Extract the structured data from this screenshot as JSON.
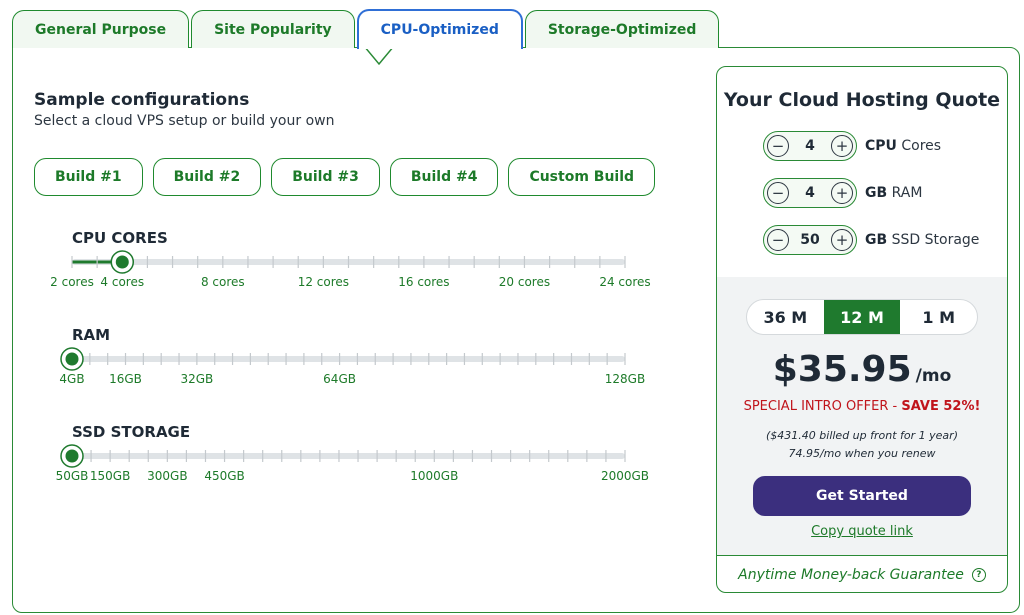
{
  "tabs": [
    {
      "label": "General Purpose",
      "active": false
    },
    {
      "label": "Site Popularity",
      "active": false
    },
    {
      "label": "CPU-Optimized",
      "active": true
    },
    {
      "label": "Storage-Optimized",
      "active": false
    }
  ],
  "configs": {
    "title": "Sample configurations",
    "subtitle": "Select a cloud VPS setup or build your own",
    "builds": [
      "Build #1",
      "Build #2",
      "Build #3",
      "Build #4",
      "Custom Build"
    ]
  },
  "sliders": [
    {
      "label": "CPU CORES",
      "value": 4,
      "min": 2,
      "max": 24,
      "tick_values": [
        2,
        3,
        4,
        5,
        6,
        7,
        8,
        9,
        10,
        11,
        12,
        13,
        14,
        15,
        16,
        17,
        18,
        19,
        20,
        21,
        22,
        23,
        24
      ],
      "labels": [
        {
          "value": 2,
          "text": "2 cores"
        },
        {
          "value": 4,
          "text": "4 cores"
        },
        {
          "value": 8,
          "text": "8 cores"
        },
        {
          "value": 12,
          "text": "12 cores"
        },
        {
          "value": 16,
          "text": "16 cores"
        },
        {
          "value": 20,
          "text": "20 cores"
        },
        {
          "value": 24,
          "text": "24 cores"
        }
      ]
    },
    {
      "label": "RAM",
      "value": 4,
      "min": 4,
      "max": 128,
      "tick_values": [
        4,
        8,
        12,
        16,
        20,
        24,
        28,
        32,
        36,
        40,
        44,
        48,
        52,
        56,
        60,
        64,
        68,
        72,
        76,
        80,
        84,
        88,
        92,
        96,
        100,
        104,
        108,
        112,
        116,
        120,
        124,
        128
      ],
      "labels": [
        {
          "value": 4,
          "text": "4GB"
        },
        {
          "value": 16,
          "text": "16GB"
        },
        {
          "value": 32,
          "text": "32GB"
        },
        {
          "value": 64,
          "text": "64GB"
        },
        {
          "value": 128,
          "text": "128GB"
        }
      ]
    },
    {
      "label": "SSD STORAGE",
      "value": 50,
      "min": 50,
      "max": 2000,
      "tick_values": [
        50,
        100,
        150,
        200,
        250,
        300,
        350,
        400,
        450,
        500,
        550,
        600,
        650,
        700,
        750,
        800,
        850,
        900,
        950,
        1000,
        1100,
        1200,
        1300,
        1400,
        1500,
        1600,
        1700,
        1800,
        1900,
        2000
      ],
      "labels": [
        {
          "value": 50,
          "text": "50GB"
        },
        {
          "value": 150,
          "text": "150GB"
        },
        {
          "value": 300,
          "text": "300GB"
        },
        {
          "value": 450,
          "text": "450GB"
        },
        {
          "value": 1000,
          "text": "1000GB"
        },
        {
          "value": 2000,
          "text": "2000GB"
        }
      ]
    }
  ],
  "quote": {
    "title": "Your Cloud Hosting Quote",
    "steppers": [
      {
        "value": "4",
        "unit_bold": "CPU",
        "unit_rest": " Cores"
      },
      {
        "value": "4",
        "unit_bold": "GB",
        "unit_rest": " RAM"
      },
      {
        "value": "50",
        "unit_bold": "GB",
        "unit_rest": " SSD Storage"
      }
    ],
    "terms": [
      {
        "label": "36 M",
        "active": false
      },
      {
        "label": "12 M",
        "active": true
      },
      {
        "label": "1 M",
        "active": false
      }
    ],
    "price": "$35.95",
    "per": "/mo",
    "offer_prefix": "SPECIAL INTRO OFFER - ",
    "offer_save": "SAVE 52%!",
    "billed_line1": "($431.40 billed up front for 1 year)",
    "billed_line2": "74.95/mo when you renew",
    "cta": "Get Started",
    "copy_link": "Copy quote link",
    "guarantee": "Anytime Money-back Guarantee",
    "help_glyph": "?"
  },
  "colors": {
    "brand_green": "#1f7a2e",
    "tab_active_blue": "#2f6fd6",
    "cta_purple": "#3b2f7e",
    "offer_red": "#c0141b"
  }
}
